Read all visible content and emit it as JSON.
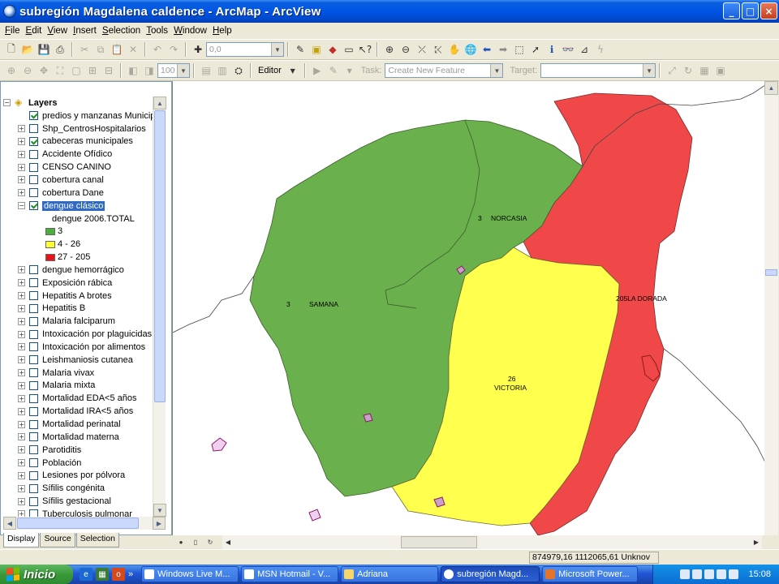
{
  "window": {
    "title": "subregión Magdalena caldence - ArcMap - ArcView",
    "controls": [
      "_",
      "□",
      "×"
    ]
  },
  "menu": [
    "File",
    "Edit",
    "View",
    "Insert",
    "Selection",
    "Tools",
    "Window",
    "Help"
  ],
  "toolbar1": {
    "scale_value": "0,0"
  },
  "toolbar2": {
    "zoom_value": "100",
    "editor_label": "Editor",
    "task_label": "Task:",
    "task_value": "Create New Feature",
    "target_label": "Target:"
  },
  "toc": {
    "root_label": "Layers",
    "layers": [
      {
        "name": "predios y manzanas Municip",
        "checked": true,
        "expander": false
      },
      {
        "name": "Shp_CentrosHospitalarios",
        "checked": false,
        "expander": true
      },
      {
        "name": "cabeceras municipales",
        "checked": true,
        "expander": true
      },
      {
        "name": "Accidente Ofídico",
        "checked": false,
        "expander": true
      },
      {
        "name": "CENSO CANINO",
        "checked": false,
        "expander": true
      },
      {
        "name": "cobertura canal",
        "checked": false,
        "expander": true
      },
      {
        "name": "cobertura Dane",
        "checked": false,
        "expander": true
      },
      {
        "name": "dengue clásico",
        "checked": true,
        "expander": true,
        "selected": true,
        "expanded": true
      }
    ],
    "legend": {
      "field": "dengue 2006.TOTAL",
      "classes": [
        {
          "label": "3",
          "color": "#4caf3c"
        },
        {
          "label": "4 - 26",
          "color": "#ffff33"
        },
        {
          "label": "27 - 205",
          "color": "#e8131b"
        }
      ]
    },
    "more_layers": [
      "dengue hemorrágico",
      "Exposición rábica",
      "Hepatitis A brotes",
      "Hepatitis B",
      "Malaria falciparum",
      "Intoxicación por plaguicidas",
      "Intoxicación por alimentos",
      "Leishmaniosis cutanea",
      "Malaria vivax",
      "Malaria mixta",
      "Mortalidad EDA<5 años",
      "Mortalidad IRA<5 años",
      "Mortalidad perinatal",
      "Mortalidad materna",
      "Parotiditis",
      "Población",
      "Lesiones por pólvora",
      "Sífilis congénita",
      "Sífilis gestacional",
      "Tuberculosis pulmonar"
    ],
    "tabs": [
      "Display",
      "Source",
      "Selection"
    ]
  },
  "map": {
    "colors": {
      "green": "#6ab04c",
      "yellow": "#ffff4d",
      "red": "#f04848"
    },
    "labels": {
      "norcasia_value": "3",
      "norcasia_name": "NORCASIA",
      "samana_value": "3",
      "samana_name": "SAMANA",
      "ladorada": "205LA DORADA",
      "victoria_value": "26",
      "victoria_name": "VICTORIA"
    }
  },
  "status": {
    "coords": "874979,16  1112065,61 Unknov"
  },
  "taskbar": {
    "start_label": "Inicio",
    "chevron": "»",
    "tasks": [
      "Windows Live M...",
      "MSN Hotmail - V...",
      "Adriana",
      "subregión Magd...",
      "Microsoft Power..."
    ],
    "clock": "15:08"
  }
}
